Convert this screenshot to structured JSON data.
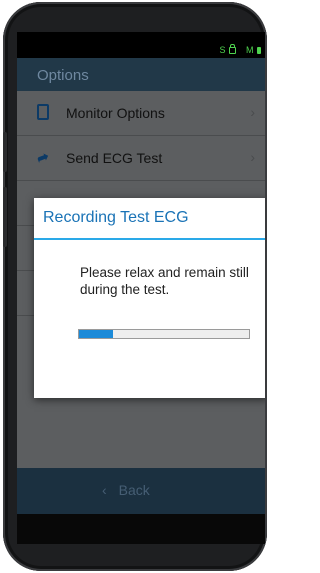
{
  "status_bar": {
    "indicators": [
      "S",
      "M"
    ]
  },
  "app": {
    "title": "Options",
    "menu": [
      {
        "label": "Monitor Options",
        "icon": "phone-icon"
      },
      {
        "label": "Send ECG Test",
        "icon": "share-icon"
      },
      {
        "label": "",
        "icon": ""
      },
      {
        "label": "",
        "icon": ""
      },
      {
        "label": "",
        "icon": ""
      }
    ],
    "back_label": "Back",
    "back_icon": "chevron-left-icon"
  },
  "dialog": {
    "title": "Recording Test ECG",
    "message": "Please relax and remain still during the test.",
    "progress": 0.2
  },
  "colors": {
    "header": "#213848",
    "dialog_title": "#1a73b6",
    "dialog_divider": "#2aa9e8",
    "progress_fill": "#1c8ad8"
  }
}
